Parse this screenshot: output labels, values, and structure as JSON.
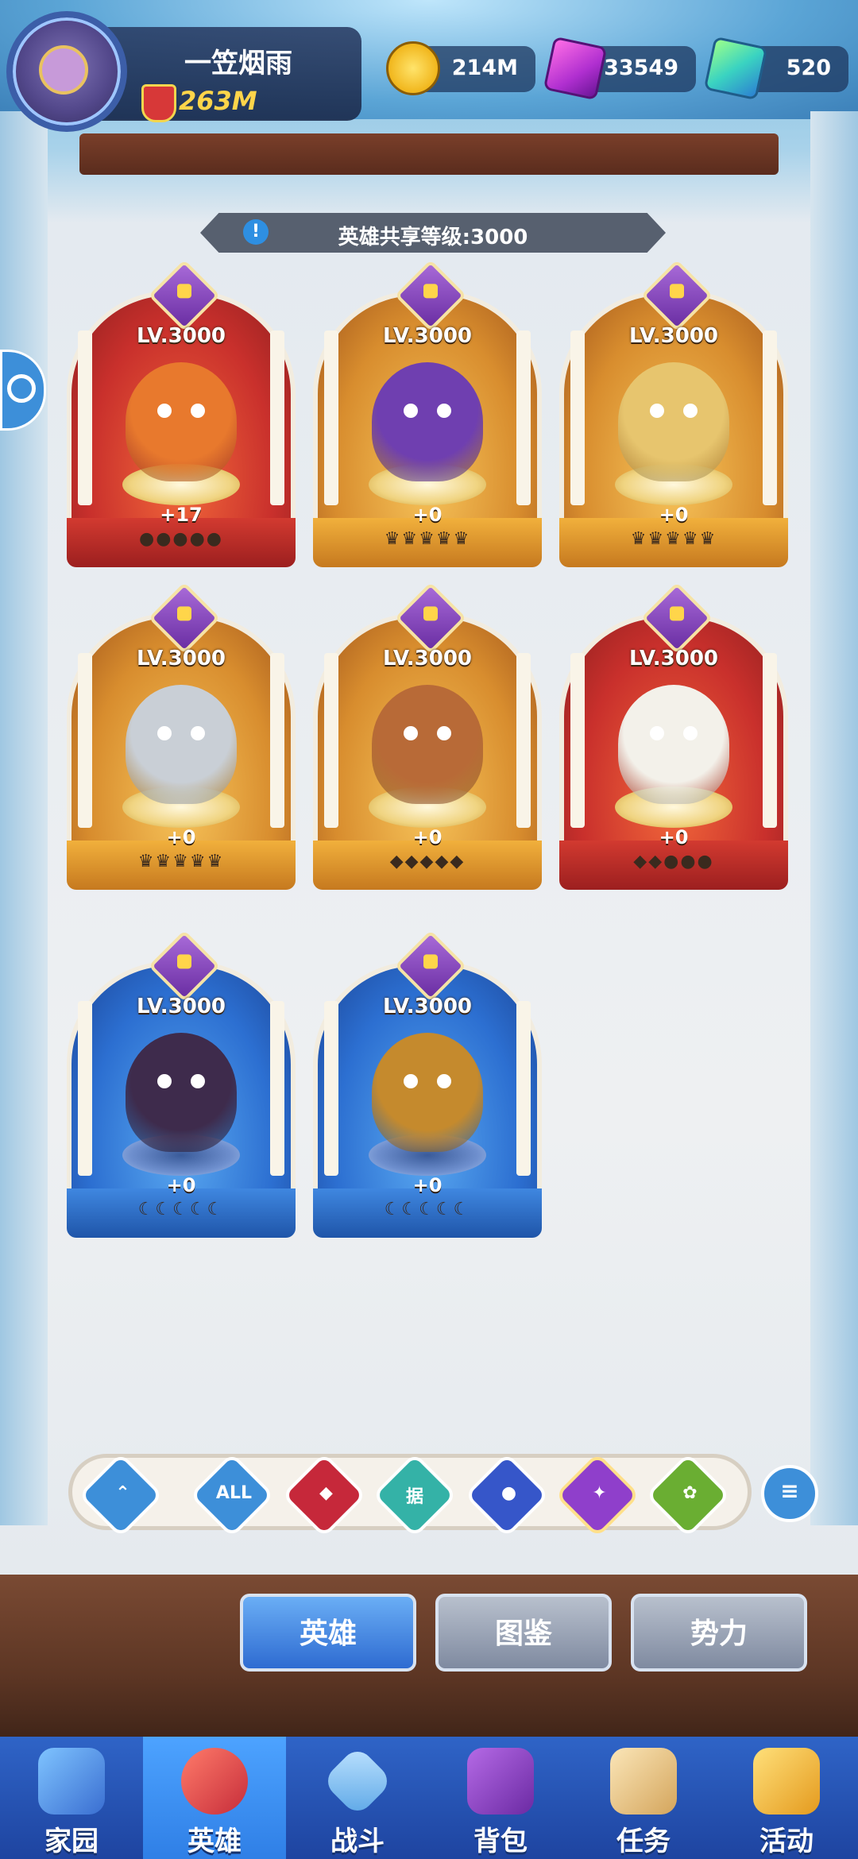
{
  "player": {
    "name": "一笠烟雨",
    "power": "263M"
  },
  "resources": {
    "coins": "214M",
    "gems": "33549",
    "crystals": "520"
  },
  "shared_level_text": "英雄共享等级:3000",
  "heroes": [
    {
      "level": "LV.3000",
      "plus": "+17",
      "rarity": "red",
      "stars": "●●●●●",
      "hero_color": "#e8792d"
    },
    {
      "level": "LV.3000",
      "plus": "+0",
      "rarity": "gold",
      "stars": "♛♛♛♛♛",
      "hero_color": "#6f3fb0"
    },
    {
      "level": "LV.3000",
      "plus": "+0",
      "rarity": "gold",
      "stars": "♛♛♛♛♛",
      "hero_color": "#e7c56e"
    },
    {
      "level": "LV.3000",
      "plus": "+0",
      "rarity": "gold",
      "stars": "♛♛♛♛♛",
      "hero_color": "#c9cfd6"
    },
    {
      "level": "LV.3000",
      "plus": "+0",
      "rarity": "gold",
      "stars": "◆◆◆◆◆",
      "hero_color": "#b86a37"
    },
    {
      "level": "LV.3000",
      "plus": "+0",
      "rarity": "red",
      "stars": "◆◆●●●",
      "hero_color": "#f3f1ea"
    },
    {
      "level": "LV.3000",
      "plus": "+0",
      "rarity": "blue",
      "stars": "☾☾☾☾☾",
      "hero_color": "#3e2b4c"
    },
    {
      "level": "LV.3000",
      "plus": "+0",
      "rarity": "blue",
      "stars": "☾☾☾☾☾",
      "hero_color": "#c58a2d"
    }
  ],
  "filters": [
    {
      "name": "faction-up",
      "glyph": "⌃",
      "color": "#3d8fd9"
    },
    {
      "name": "all",
      "glyph": "ALL",
      "color": "#3d8fd9"
    },
    {
      "name": "demon",
      "glyph": "◆",
      "color": "#c6283a"
    },
    {
      "name": "ju",
      "glyph": "据",
      "color": "#34b2a7"
    },
    {
      "name": "orb",
      "glyph": "●",
      "color": "#3656c9"
    },
    {
      "name": "holy",
      "glyph": "✦",
      "color": "#8f3fcb"
    },
    {
      "name": "nature",
      "glyph": "✿",
      "color": "#6aae32"
    }
  ],
  "sort_label": "≡",
  "sub_tabs": [
    "英雄",
    "图鉴",
    "势力"
  ],
  "nav": [
    "家园",
    "英雄",
    "战斗",
    "背包",
    "任务",
    "活动"
  ],
  "colors": {
    "red_card": "#c9302c",
    "gold_card": "#d88d2e",
    "blue_card": "#2c6fd1",
    "nav_blue": "#2f64c7"
  }
}
